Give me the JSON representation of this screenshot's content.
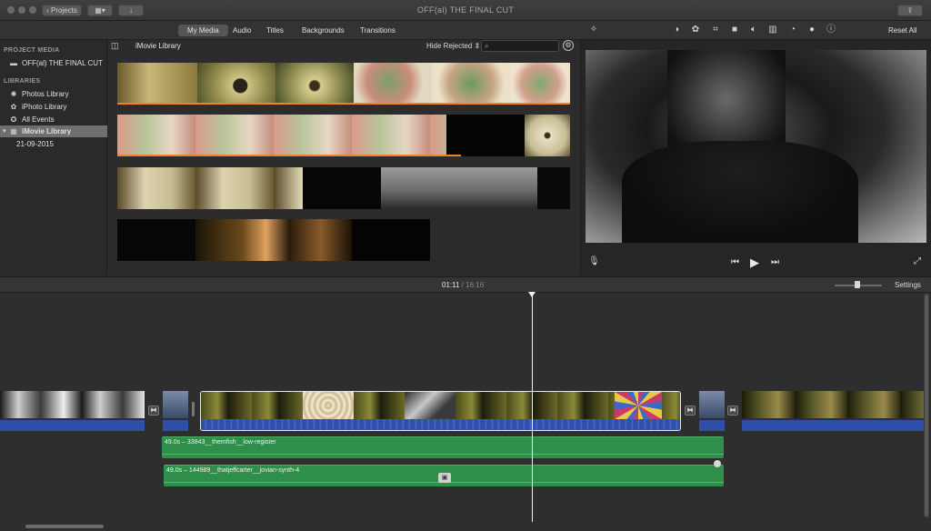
{
  "window": {
    "title": "OFF(al) THE FINAL CUT",
    "projects_button": "Projects"
  },
  "toolbar": {
    "tabs": [
      "My Media",
      "Audio",
      "Titles",
      "Backgrounds",
      "Transitions"
    ],
    "active_tab": "My Media",
    "reset_all": "Reset All"
  },
  "sidebar": {
    "project_media_header": "PROJECT MEDIA",
    "project_item": "OFF(al) THE FINAL CUT",
    "libraries_header": "LIBRARIES",
    "items": [
      {
        "label": "Photos Library",
        "icon": "photos-icon"
      },
      {
        "label": "iPhoto Library",
        "icon": "iphoto-icon"
      },
      {
        "label": "All Events",
        "icon": "star-icon"
      },
      {
        "label": "iMovie Library",
        "icon": "library-grid-icon",
        "selected": true
      },
      {
        "label": "21-09-2015",
        "icon": ""
      }
    ]
  },
  "browser": {
    "title": "iMovie Library",
    "filter": "Hide Rejected",
    "search_placeholder": ""
  },
  "timeline": {
    "current_time": "01:11",
    "separator": "/",
    "total_time": "16:16",
    "settings": "Settings",
    "music_tracks": [
      {
        "label": "49.0s – 33843__themfish__low-register"
      },
      {
        "label": "49.0s – 144989__thatjeffcarter__jovian-synth-4"
      }
    ]
  },
  "colors": {
    "accent_orange": "#e8852b",
    "audio_blue": "#2f4fa8",
    "music_green": "#2d8f4a"
  }
}
